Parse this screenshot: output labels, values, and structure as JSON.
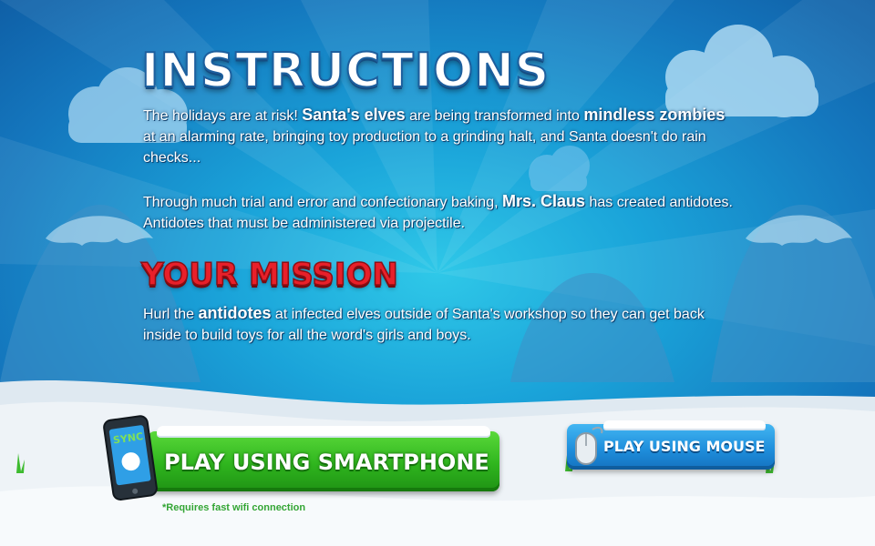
{
  "title": "INSTRUCTIONS",
  "intro": {
    "t1": "The holidays are at risk! ",
    "b1": "Santa's elves",
    "t2": " are being transformed into ",
    "b2": "mindless zombies",
    "t3": " at an alarming rate, bringing toy production to a grinding halt, and Santa doesn't do rain checks..."
  },
  "antidote_para": {
    "t1": "Through much trial and error and confectionary baking, ",
    "b1": "Mrs. Claus",
    "t2": " has created antidotes. Antidotes that must be administered via projectile."
  },
  "mission_title": "YOUR MISSION",
  "mission_para": {
    "t1": "Hurl the ",
    "b1": "antidotes",
    "t2": " at infected elves outside of Santa's workshop so they can get back inside to build toys for all the word's girls and boys."
  },
  "phone_screen_label": "SYNC",
  "smartphone_button": "PLAY USING SMARTPHONE",
  "requirement_note": "*Requires fast wifi connection",
  "mouse_button": "PLAY USING MOUSE",
  "colors": {
    "sky": "#1a8fd0",
    "title_white": "#ffffff",
    "mission_red": "#e8202a",
    "green_button": "#2fb51e",
    "blue_button": "#1f8fdc",
    "note_green": "#33a534"
  },
  "icons": [
    "smartphone-icon",
    "mouse-icon",
    "grass-tuft-icon"
  ]
}
